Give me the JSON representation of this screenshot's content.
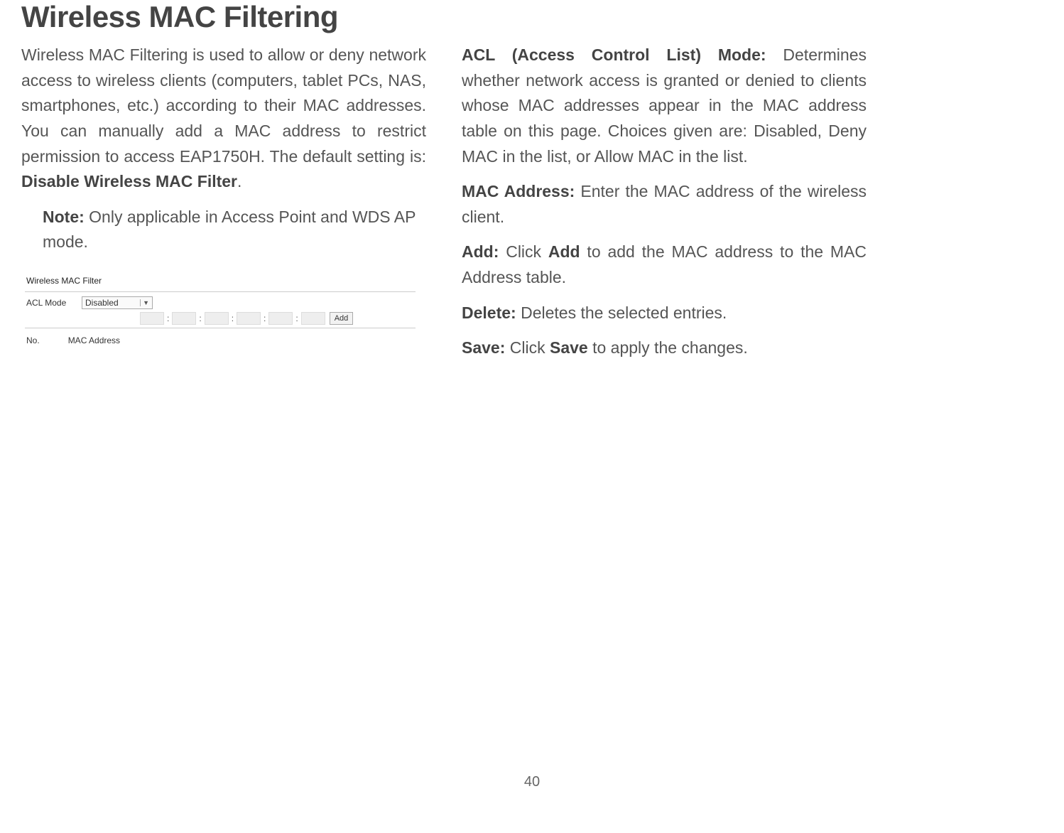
{
  "title": "Wireless MAC Filtering",
  "intro": {
    "part1": "Wireless MAC Filtering is used to allow or deny network access to wireless clients (computers, tablet PCs, NAS, smartphones, etc.) according to their MAC addresses. You can manually add a MAC address to restrict permission to access EAP1750H. The default setting is: ",
    "bold": "Disable Wireless MAC Filter",
    "part2": "."
  },
  "note": {
    "label": "Note:",
    "text": "  Only applicable in Access Point and WDS AP mode."
  },
  "screenshot": {
    "section_title": "Wireless MAC Filter",
    "acl_label": "ACL Mode",
    "acl_value": "Disabled",
    "add_button": "Add",
    "col_no": "No.",
    "col_mac": "MAC Address"
  },
  "defs": {
    "acl": {
      "label": "ACL (Access Control List) Mode:",
      "text": " Determines whether network access is granted or denied to clients whose MAC addresses appear in the MAC address table on this page. Choices given are: Disabled, Deny MAC in the list, or Allow MAC in the list."
    },
    "mac": {
      "label": "MAC Address:",
      "text": " Enter the MAC address of the wireless client."
    },
    "add": {
      "label": "Add:",
      "text_before": " Click ",
      "bold": "Add",
      "text_after": " to add the MAC address to the MAC Address table."
    },
    "delete": {
      "label": "Delete:",
      "text": " Deletes the selected entries."
    },
    "save": {
      "label": "Save:",
      "text_before": " Click ",
      "bold": "Save",
      "text_after": " to apply the changes."
    }
  },
  "page_number": "40"
}
